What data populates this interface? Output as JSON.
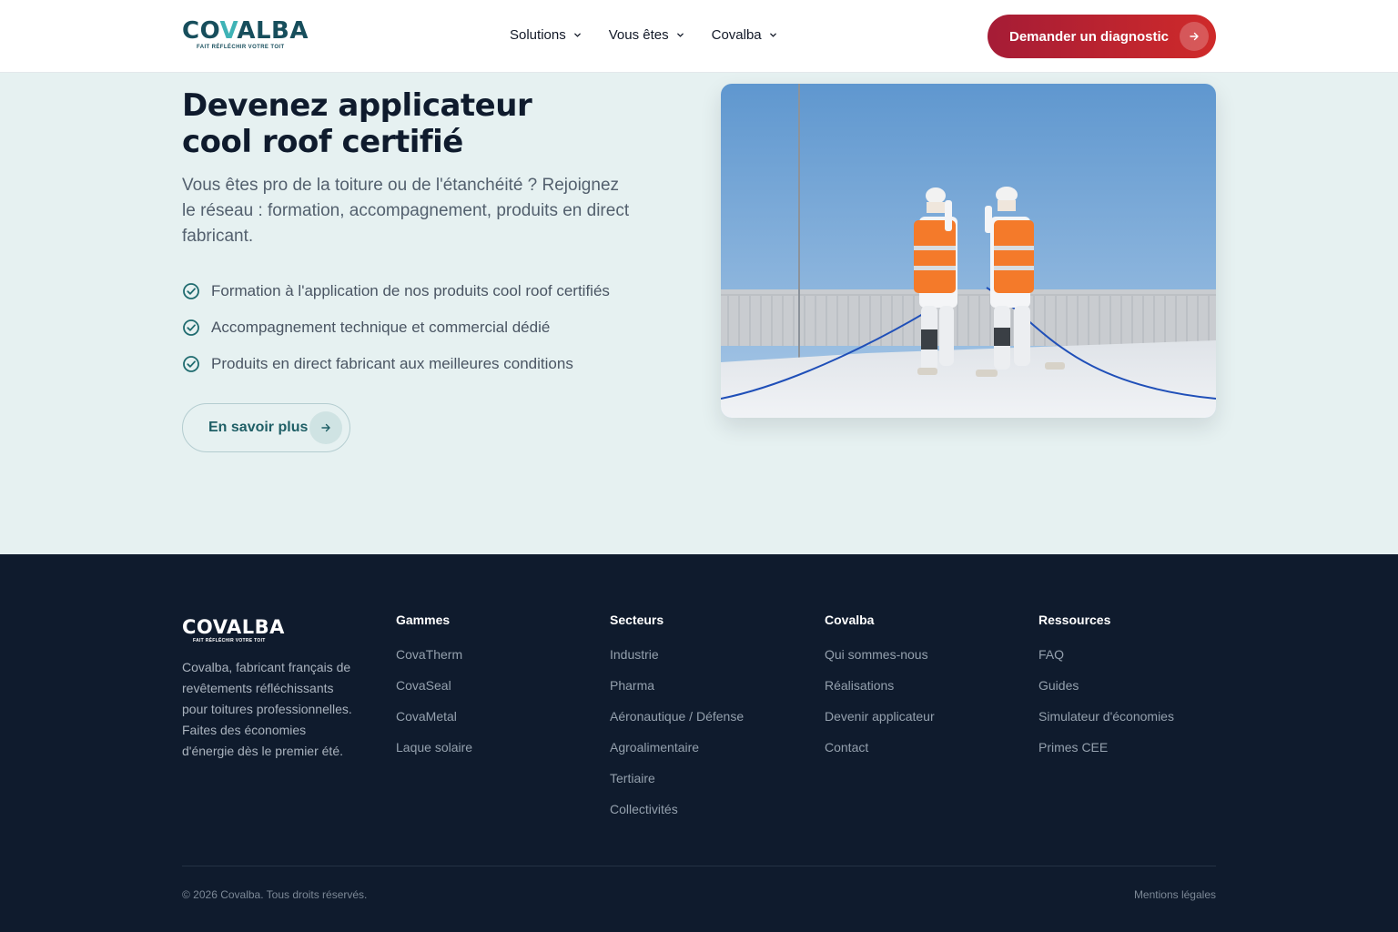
{
  "header": {
    "logo": {
      "text_a": "CO",
      "text_b": "V",
      "text_c": "ALBA",
      "tagline": "FAIT RÉFLÉCHIR VOTRE TOIT"
    },
    "nav": [
      {
        "label": "Solutions"
      },
      {
        "label": "Vous êtes"
      },
      {
        "label": "Covalba"
      }
    ],
    "cta_label": "Demander un diagnostic"
  },
  "hero": {
    "title_line1": "Devenez applicateur",
    "title_line2": "cool roof certifié",
    "description": "Vous êtes pro de la toiture ou de l'étanchéité ? Rejoignez le réseau : formation, accompagnement, produits en direct fabricant.",
    "checks": [
      "Formation à l'application de nos produits cool roof certifiés",
      "Accompagnement technique et commercial dédié",
      "Produits en direct fabricant aux meilleures conditions"
    ],
    "button_label": "En savoir plus"
  },
  "footer": {
    "logo": {
      "text": "COVALBA",
      "tagline": "FAIT RÉFLÉCHIR VOTRE TOIT"
    },
    "description": "Covalba, fabricant français de revêtements réfléchissants pour toitures professionnelles. Faites des économies d'énergie dès le premier été.",
    "columns": [
      {
        "title": "Gammes",
        "links": [
          "CovaTherm",
          "CovaSeal",
          "CovaMetal",
          "Laque solaire"
        ]
      },
      {
        "title": "Secteurs",
        "links": [
          "Industrie",
          "Pharma",
          "Aéronautique / Défense",
          "Agroalimentaire",
          "Tertiaire",
          "Collectivités"
        ]
      },
      {
        "title": "Covalba",
        "links": [
          "Qui sommes-nous",
          "Réalisations",
          "Devenir applicateur",
          "Contact"
        ]
      },
      {
        "title": "Ressources",
        "links": [
          "FAQ",
          "Guides",
          "Simulateur d'économies",
          "Primes CEE"
        ]
      }
    ],
    "copyright": "© 2026 Covalba. Tous droits réservés.",
    "legal": "Mentions légales"
  },
  "colors": {
    "brand_teal": "#174e5c",
    "accent_teal": "#3fb3b6",
    "cta_red": "#b8203a",
    "footer_bg": "#0f1b2d",
    "hero_bg": "#e6f1f1"
  }
}
